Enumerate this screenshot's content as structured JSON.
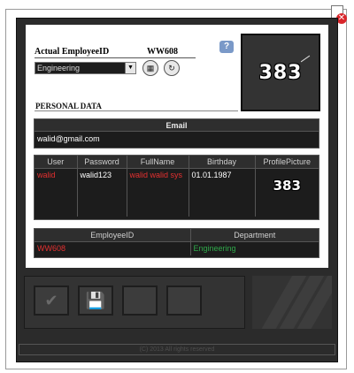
{
  "window": {
    "close_icon": "close-icon"
  },
  "employee": {
    "id_label": "Actual EmployeeID",
    "id_value": "WW608",
    "department": "Engineering"
  },
  "logo_text": "383",
  "personal_data_label": "PERSONAL DATA",
  "email_section": {
    "header": "Email",
    "value": "walid@gmail.com"
  },
  "user_table": {
    "headers": [
      "User",
      "Password",
      "FullName",
      "Birthday",
      "ProfilePicture"
    ],
    "row": {
      "user": "walid",
      "password": "walid123",
      "fullname": "walid walid sys",
      "birthday": "01.01.1987",
      "picture_text": "383"
    }
  },
  "dept_table": {
    "headers": [
      "EmployeeID",
      "Department"
    ],
    "row": {
      "employee_id": "WW608",
      "department": "Engineering"
    }
  },
  "toolbar": {
    "buttons": [
      "check-icon",
      "save-icon",
      "blank",
      "blank"
    ]
  },
  "status_bar": {
    "text": "(C) 2013 All rights reserved"
  },
  "colors": {
    "accent_red": "#e53030",
    "accent_green": "#2fa84a"
  }
}
